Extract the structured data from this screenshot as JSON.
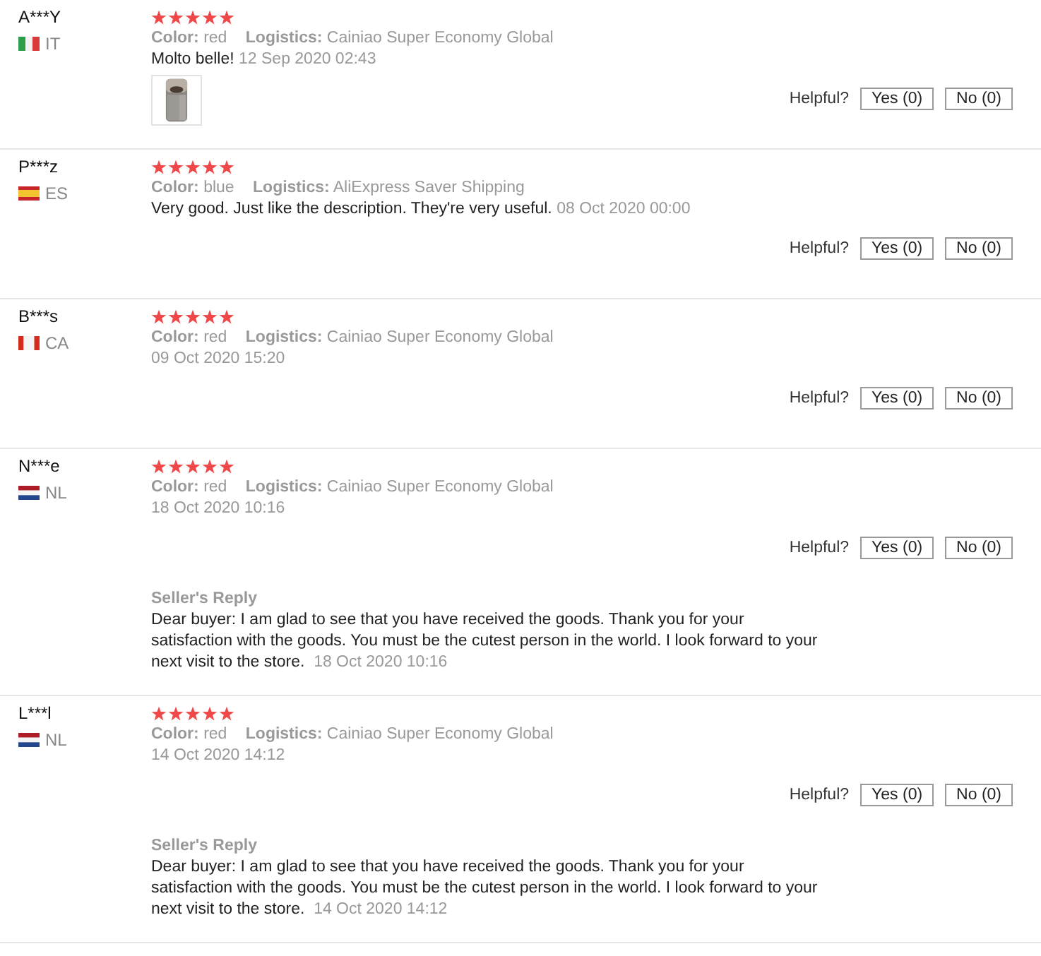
{
  "reviews": [
    {
      "user": "A***Y",
      "country": {
        "code": "IT",
        "flag": {
          "kind": "vertical",
          "bands": [
            {
              "color": "#2e9e4a"
            },
            {
              "color": "#f2f2f2"
            },
            {
              "color": "#d93a3a"
            }
          ]
        }
      },
      "stars": 5,
      "color_label": "Color:",
      "color_name": "red",
      "logistics_label": "Logistics:",
      "logistics": "Cainiao Super Economy Global",
      "text": "Molto belle!",
      "date": "12 Sep 2020 02:43",
      "photos": [
        {
          "kind": "picture"
        }
      ],
      "helpful": {
        "label": "Helpful?",
        "yes": "Yes (0)",
        "no": "No (0)"
      }
    },
    {
      "user": "P***z",
      "country": {
        "code": "ES",
        "flag": {
          "kind": "horizontal",
          "bands": [
            {
              "color": "#c8242c"
            },
            {
              "color": "#f4c430"
            },
            {
              "color": "#f4c430"
            },
            {
              "color": "#c8242c"
            }
          ]
        }
      },
      "stars": 5,
      "color_label": "Color:",
      "color_name": "blue",
      "logistics_label": "Logistics:",
      "logistics": "AliExpress Saver Shipping",
      "text": "Very good. Just like the description. They're very useful.",
      "date": "08 Oct 2020 00:00",
      "helpful": {
        "label": "Helpful?",
        "yes": "Yes (0)",
        "no": "No (0)"
      }
    },
    {
      "user": "B***s",
      "country": {
        "code": "CA",
        "flag": {
          "kind": "vertical",
          "bands": [
            {
              "color": "#d52b1e"
            },
            {
              "color": "#f4f4f4"
            },
            {
              "color": "#f4f4f4"
            },
            {
              "color": "#d52b1e"
            }
          ]
        }
      },
      "stars": 5,
      "color_label": "Color:",
      "color_name": "red",
      "logistics_label": "Logistics:",
      "logistics": "Cainiao Super Economy Global",
      "date": "09 Oct 2020 15:20",
      "helpful": {
        "label": "Helpful?",
        "yes": "Yes (0)",
        "no": "No (0)"
      }
    },
    {
      "user": "N***e",
      "country": {
        "code": "NL",
        "flag": {
          "kind": "horizontal",
          "bands": [
            {
              "color": "#ae1c28"
            },
            {
              "color": "#f4f4f4"
            },
            {
              "color": "#21468b"
            }
          ]
        }
      },
      "stars": 5,
      "color_label": "Color:",
      "color_name": "red",
      "logistics_label": "Logistics:",
      "logistics": "Cainiao Super Economy Global",
      "date": "18 Oct 2020 10:16",
      "helpful": {
        "label": "Helpful?",
        "yes": "Yes (0)",
        "no": "No (0)"
      },
      "seller_reply": {
        "title": "Seller's Reply",
        "text": "Dear buyer: I am glad to see that you have received the goods. Thank you for your satisfaction with the goods. You must be the cutest person in the world. I look forward to your next visit to the store.",
        "date": "18 Oct 2020 10:16"
      }
    },
    {
      "user": "L***l",
      "country": {
        "code": "NL",
        "flag": {
          "kind": "horizontal",
          "bands": [
            {
              "color": "#ae1c28"
            },
            {
              "color": "#f4f4f4"
            },
            {
              "color": "#21468b"
            }
          ]
        }
      },
      "stars": 5,
      "color_label": "Color:",
      "color_name": "red",
      "logistics_label": "Logistics:",
      "logistics": "Cainiao Super Economy Global",
      "date": "14 Oct 2020 14:12",
      "helpful": {
        "label": "Helpful?",
        "yes": "Yes (0)",
        "no": "No (0)"
      },
      "seller_reply": {
        "title": "Seller's Reply",
        "text": "Dear buyer: I am glad to see that you have received the goods. Thank you for your satisfaction with the goods. You must be the cutest person in the world. I look forward to your next visit to the store.",
        "date": "14 Oct 2020 14:12"
      }
    }
  ]
}
